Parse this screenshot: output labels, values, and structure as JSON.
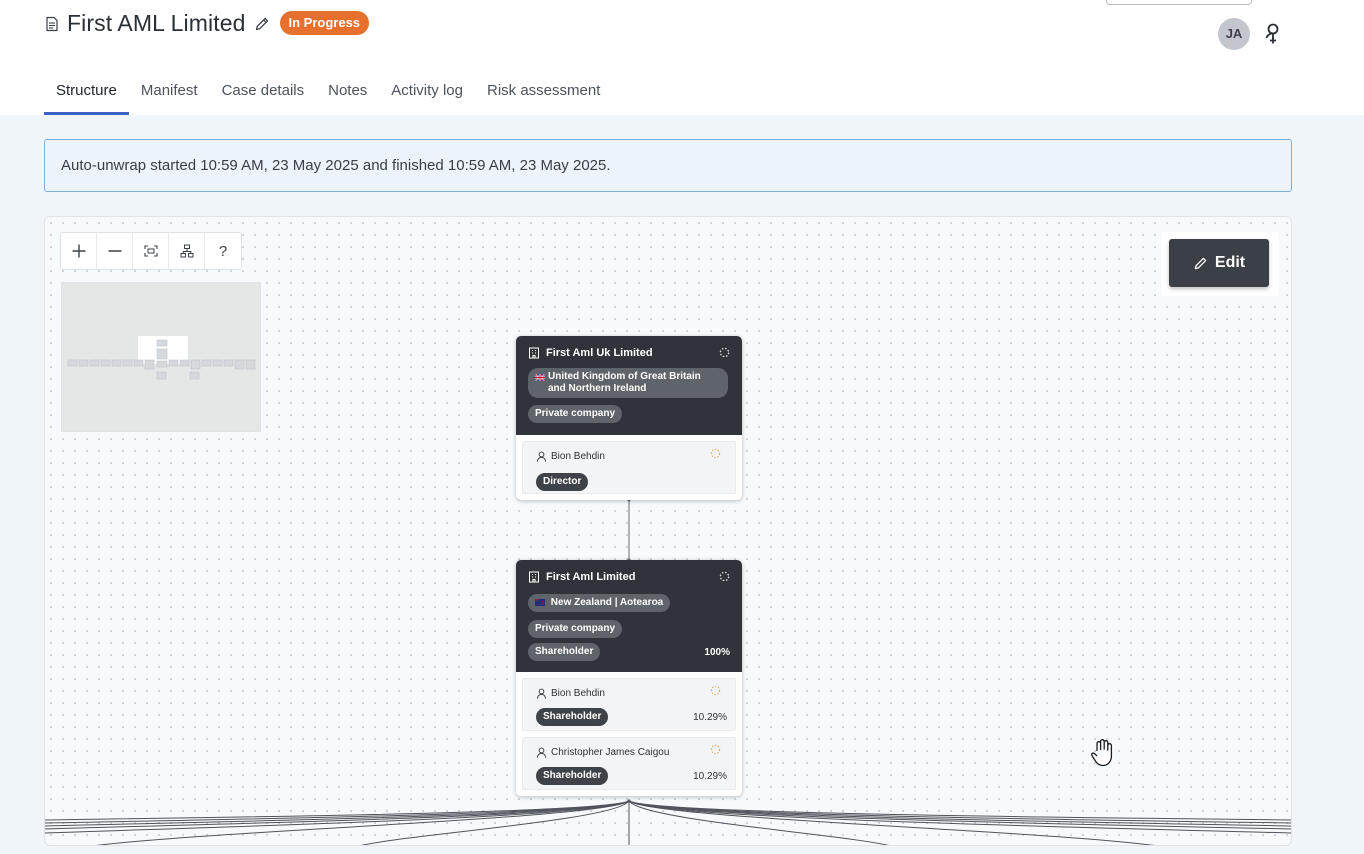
{
  "header": {
    "title": "First AML Limited",
    "status": "In Progress",
    "status_color": "#e7702f",
    "avatar_initials": "JA",
    "icons": [
      "document-icon",
      "pencil-icon",
      "assign-user-icon"
    ]
  },
  "tabs": [
    {
      "label": "Structure",
      "active": true
    },
    {
      "label": "Manifest",
      "active": false
    },
    {
      "label": "Case details",
      "active": false
    },
    {
      "label": "Notes",
      "active": false
    },
    {
      "label": "Activity log",
      "active": false
    },
    {
      "label": "Risk assessment",
      "active": false
    }
  ],
  "banner": {
    "text": "Auto-unwrap started 10:59 AM, 23 May 2025 and finished 10:59 AM, 23 May 2025."
  },
  "canvas": {
    "zoom_controls": [
      {
        "icon": "zoom-in-icon",
        "glyph": "+"
      },
      {
        "icon": "zoom-out-icon",
        "glyph": "−"
      },
      {
        "icon": "fit-view-icon",
        "glyph": ""
      },
      {
        "icon": "auto-layout-icon",
        "glyph": ""
      },
      {
        "icon": "help-icon",
        "glyph": "?"
      }
    ],
    "edit_label": "Edit",
    "entities": [
      {
        "name": "First Aml Uk Limited",
        "country": "United Kingdom of Great Britain and Northern Ireland",
        "type": "Private company",
        "people": [
          {
            "name": "Bion Behdin",
            "role": "Director"
          }
        ]
      },
      {
        "name": "First Aml Limited",
        "country": "New Zealand | Aotearoa",
        "type": "Private company",
        "relation": "Shareholder",
        "relation_pct": "100%",
        "people": [
          {
            "name": "Bion Behdin",
            "role": "Shareholder",
            "pct": "10.29%"
          },
          {
            "name": "Christopher James Caigou",
            "role": "Shareholder",
            "pct": "10.29%"
          }
        ]
      }
    ]
  }
}
